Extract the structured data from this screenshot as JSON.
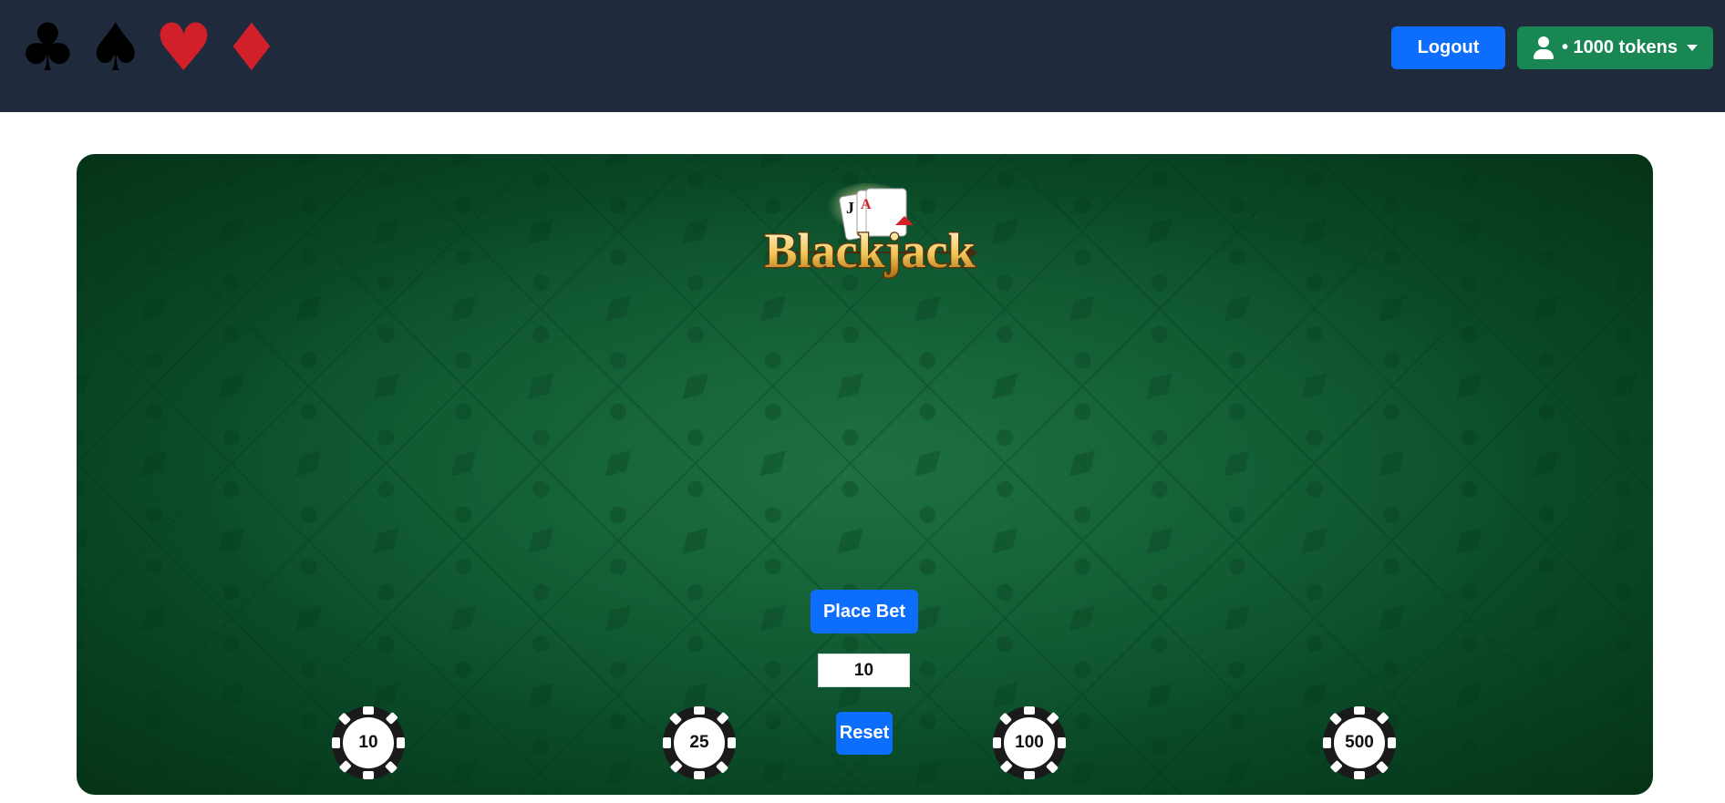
{
  "header": {
    "suits": [
      {
        "name": "clubs",
        "glyph": "♣",
        "color": "#000000"
      },
      {
        "name": "spades",
        "glyph": "♠",
        "color": "#000000"
      },
      {
        "name": "hearts",
        "glyph": "♥",
        "color": "#d1202a"
      },
      {
        "name": "diamonds",
        "glyph": "♦",
        "color": "#d1202a"
      }
    ],
    "logout_label": "Logout",
    "tokens_label": "• 1000 tokens",
    "user_icon": "user-icon"
  },
  "game": {
    "logo_text": "Blackjack",
    "logo_cards": [
      "J",
      "A"
    ],
    "place_bet_label": "Place Bet",
    "bet_value": "10",
    "reset_label": "Reset",
    "chips": [
      {
        "value": "10"
      },
      {
        "value": "25"
      },
      {
        "value": "100"
      },
      {
        "value": "500"
      }
    ]
  },
  "colors": {
    "navbar": "#1f2a3c",
    "primary": "#0d6efd",
    "success": "#198754",
    "table": "#0b4f2b"
  }
}
